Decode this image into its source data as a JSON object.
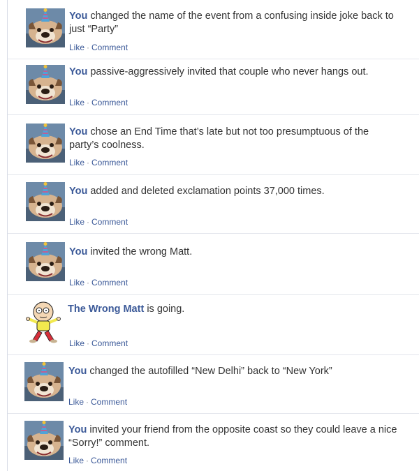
{
  "stories": [
    {
      "actor": "You",
      "text": "changed the name of the event from a confusing inside joke back to just “Party”",
      "avatar": "bulldog-party-hat-photo",
      "like": "Like",
      "comment": "Comment",
      "separator": "·"
    },
    {
      "actor": "You",
      "text": "passive-aggressively invited that couple who never hangs out.",
      "avatar": "bulldog-party-hat-photo",
      "like": "Like",
      "comment": "Comment",
      "separator": "·"
    },
    {
      "actor": "You",
      "text": "chose an End Time that’s late but not too presumptuous of the party’s coolness.",
      "avatar": "bulldog-party-hat-photo",
      "like": "Like",
      "comment": "Comment",
      "separator": "·"
    },
    {
      "actor": "You",
      "text": "added and deleted exclamation points 37,000 times.",
      "avatar": "bulldog-party-hat-photo",
      "like": "Like",
      "comment": "Comment",
      "separator": "·"
    },
    {
      "actor": "You",
      "text": "invited the wrong Matt.",
      "avatar": "bulldog-party-hat-photo",
      "like": "Like",
      "comment": "Comment",
      "separator": "·"
    },
    {
      "actor": "The Wrong Matt",
      "text": "is going.",
      "avatar": "cartoon-character",
      "like": "Like",
      "comment": "Comment",
      "separator": "·"
    },
    {
      "actor": "You",
      "text": "changed the autofilled “New Delhi” back to “New York”",
      "avatar": "bulldog-party-hat-photo",
      "like": "Like",
      "comment": "Comment",
      "separator": "·"
    },
    {
      "actor": "You",
      "text": "invited your friend from the opposite coast so they could leave a nice “Sorry!” comment.",
      "avatar": "bulldog-party-hat-photo",
      "like": "Like",
      "comment": "Comment",
      "separator": "·"
    }
  ],
  "colors": {
    "link": "#3b5998",
    "body_text": "#333333",
    "separator": "#8a8f99",
    "divider": "#e3e6ec"
  }
}
